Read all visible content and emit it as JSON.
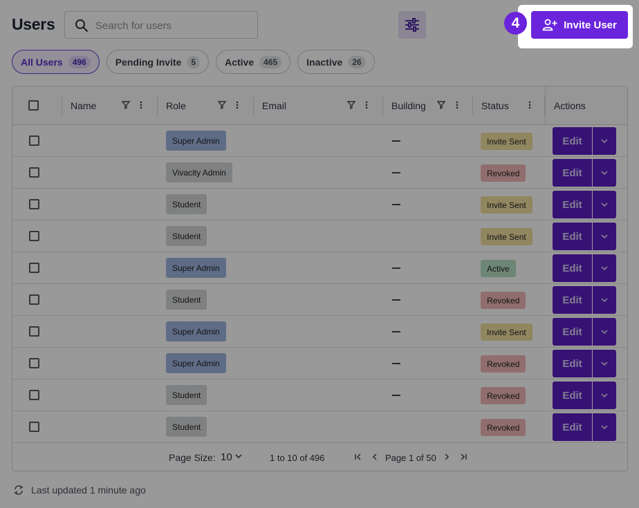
{
  "header": {
    "title": "Users",
    "search_placeholder": "Search for users",
    "search_value": "",
    "invite_label": "Invite User",
    "step_number": "4"
  },
  "filters": [
    {
      "label": "All Users",
      "count": "496",
      "selected": true
    },
    {
      "label": "Pending Invite",
      "count": "5",
      "selected": false
    },
    {
      "label": "Active",
      "count": "465",
      "selected": false
    },
    {
      "label": "Inactive",
      "count": "26",
      "selected": false
    }
  ],
  "table": {
    "columns": {
      "name": "Name",
      "role": "Role",
      "email": "Email",
      "building": "Building",
      "status": "Status",
      "actions": "Actions"
    },
    "edit_label": "Edit",
    "rows": [
      {
        "role": "Super Admin",
        "building": "–",
        "status": "Invite Sent"
      },
      {
        "role": "Vivacity Admin",
        "building": "–",
        "status": "Revoked"
      },
      {
        "role": "Student",
        "building": "–",
        "status": "Invite Sent"
      },
      {
        "role": "Student",
        "building": "",
        "status": "Invite Sent"
      },
      {
        "role": "Super Admin",
        "building": "–",
        "status": "Active"
      },
      {
        "role": "Student",
        "building": "–",
        "status": "Revoked"
      },
      {
        "role": "Super Admin",
        "building": "–",
        "status": "Invite Sent"
      },
      {
        "role": "Super Admin",
        "building": "–",
        "status": "Revoked"
      },
      {
        "role": "Student",
        "building": "–",
        "status": "Revoked"
      },
      {
        "role": "Student",
        "building": "",
        "status": "Revoked"
      }
    ]
  },
  "pagination": {
    "page_size_label": "Page Size:",
    "page_size_value": "10",
    "range_text": "1 to 10 of 496",
    "page_text": "Page 1 of 50"
  },
  "footer": {
    "last_updated": "Last updated 1 minute ago"
  },
  "colors": {
    "accent": "#6a24dc",
    "edit_button": "#5b1fc4",
    "overlay": "rgba(0,0,0,0.4)"
  }
}
